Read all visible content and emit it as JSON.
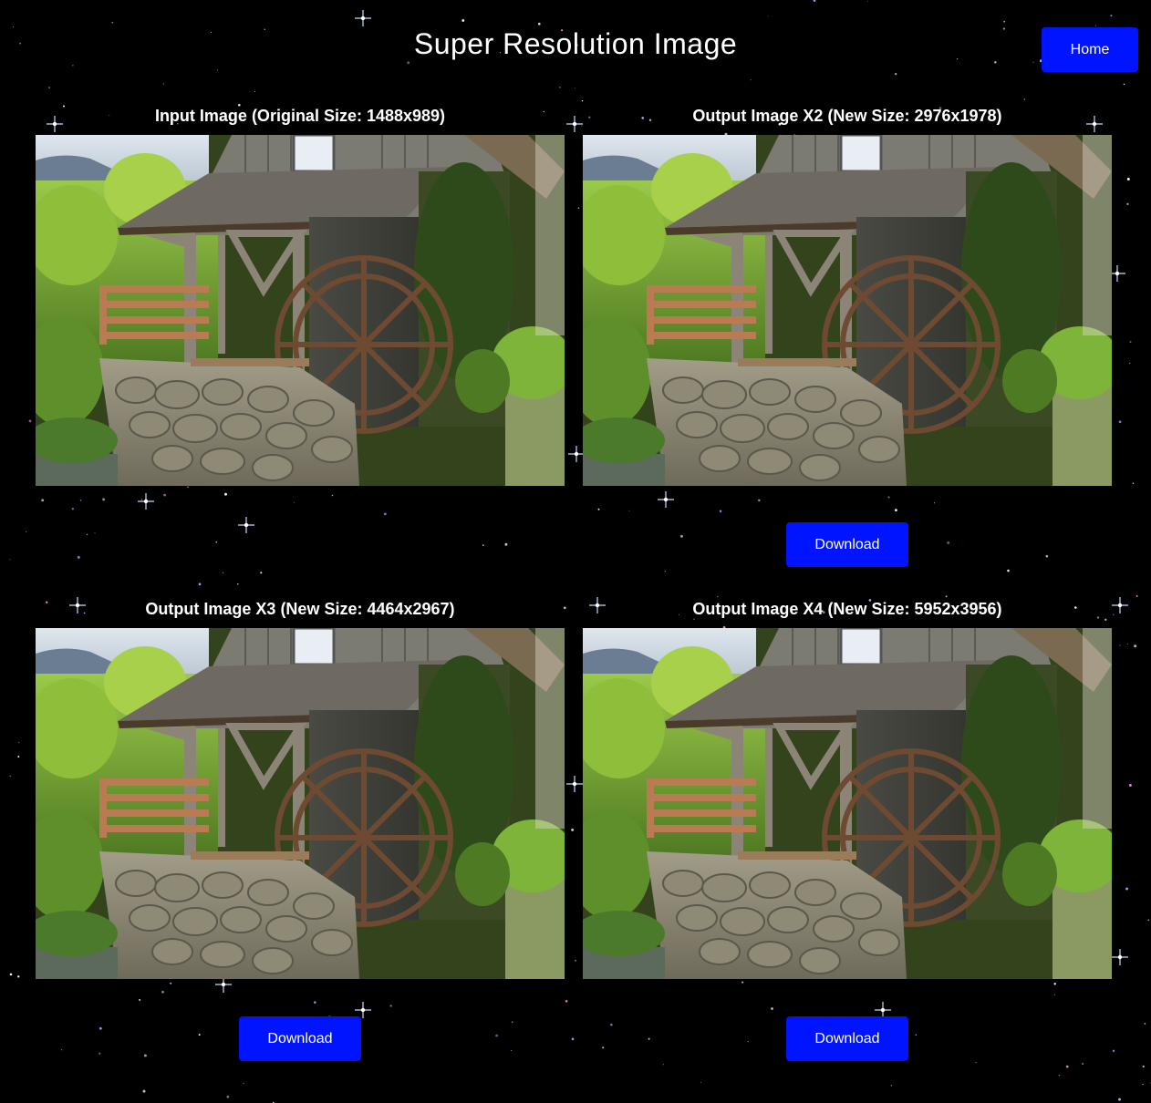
{
  "page": {
    "title": "Super Resolution Image",
    "home_label": "Home",
    "download_label": "Download"
  },
  "colors": {
    "background": "#000000",
    "button": "#0014ff",
    "text": "#ffffff"
  },
  "panels": [
    {
      "caption": "Input Image (Original Size: 1488x989)",
      "has_download": false
    },
    {
      "caption": "Output Image X2 (New Size: 2976x1978)",
      "has_download": true
    },
    {
      "caption": "Output Image X3 (New Size: 4464x2967)",
      "has_download": true
    },
    {
      "caption": "Output Image X4 (New Size: 5952x3956)",
      "has_download": true
    }
  ]
}
